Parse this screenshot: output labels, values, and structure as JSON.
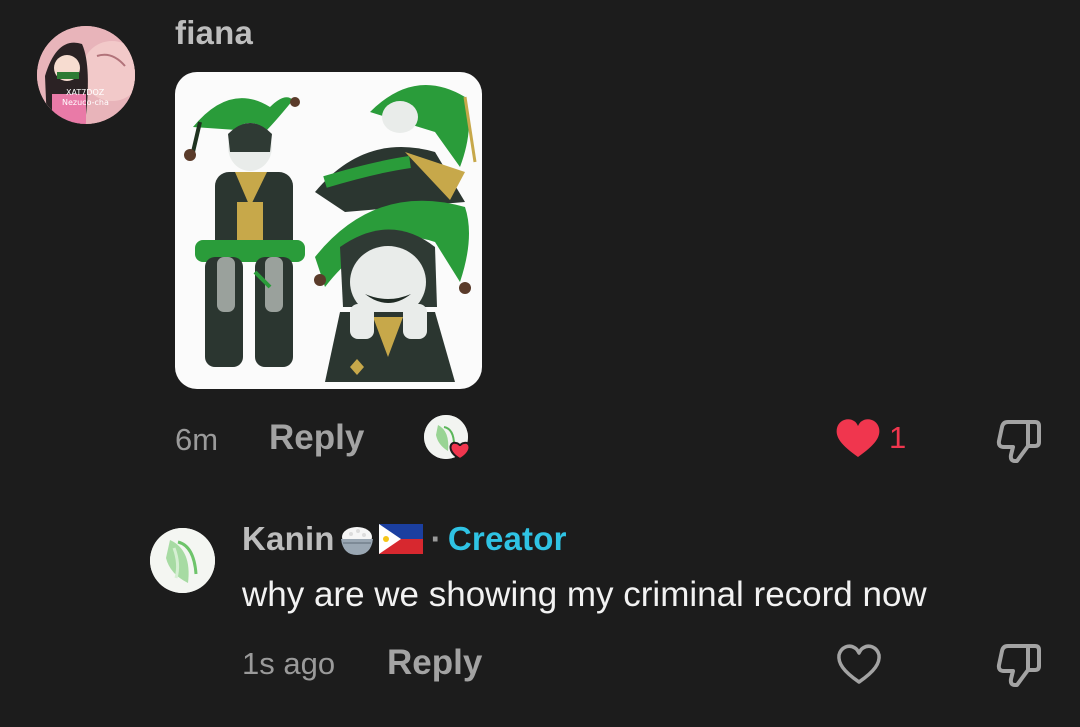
{
  "comment": {
    "username": "fiana",
    "avatar_text": [
      "XAT7DOZ",
      "Nezuco-cha"
    ],
    "timestamp": "6m",
    "reply_label": "Reply",
    "like_count": "1",
    "liked": true,
    "attachment_icon": "image-icon"
  },
  "reply": {
    "username": "Kanin",
    "username_emojis": [
      "rice-bowl-icon",
      "philippines-flag-icon"
    ],
    "separator": "·",
    "badge": "Creator",
    "text": "why are we showing my criminal record now",
    "timestamp": "1s ago",
    "reply_label": "Reply"
  },
  "colors": {
    "background": "#1c1c1c",
    "like_red": "#f0364e",
    "creator_blue": "#2fc3e4",
    "muted_text": "#9a9a9a"
  }
}
